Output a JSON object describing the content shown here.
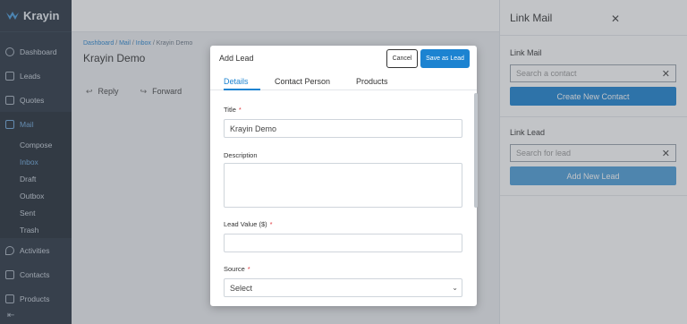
{
  "app": {
    "name": "Krayin"
  },
  "sidebar": {
    "items": [
      {
        "label": "Dashboard"
      },
      {
        "label": "Leads"
      },
      {
        "label": "Quotes"
      },
      {
        "label": "Mail"
      },
      {
        "label": "Activities"
      },
      {
        "label": "Contacts"
      },
      {
        "label": "Products"
      }
    ],
    "mail_sub": [
      {
        "label": "Compose"
      },
      {
        "label": "Inbox"
      },
      {
        "label": "Draft"
      },
      {
        "label": "Outbox"
      },
      {
        "label": "Sent"
      },
      {
        "label": "Trash"
      }
    ]
  },
  "breadcrumb": {
    "dashboard": "Dashboard",
    "mail": "Mail",
    "inbox": "Inbox",
    "current": "Krayin Demo"
  },
  "page": {
    "title": "Krayin Demo",
    "reply": "Reply",
    "forward": "Forward"
  },
  "panel": {
    "title": "Link Mail",
    "link_mail_label": "Link Mail",
    "contact_placeholder": "Search a contact",
    "create_contact": "Create New Contact",
    "link_lead_label": "Link Lead",
    "lead_placeholder": "Search for lead",
    "add_lead": "Add New Lead"
  },
  "modal": {
    "title": "Add Lead",
    "cancel": "Cancel",
    "save": "Save as Lead",
    "tabs": [
      {
        "label": "Details"
      },
      {
        "label": "Contact Person"
      },
      {
        "label": "Products"
      }
    ],
    "fields": {
      "title_label": "Title",
      "title_value": "Krayin Demo",
      "description_label": "Description",
      "lead_value_label": "Lead Value ($)",
      "source_label": "Source",
      "source_value": "Select"
    }
  },
  "colors": {
    "accent": "#1c83d1",
    "sidebar": "#2a3542",
    "required": "#e0393e"
  }
}
